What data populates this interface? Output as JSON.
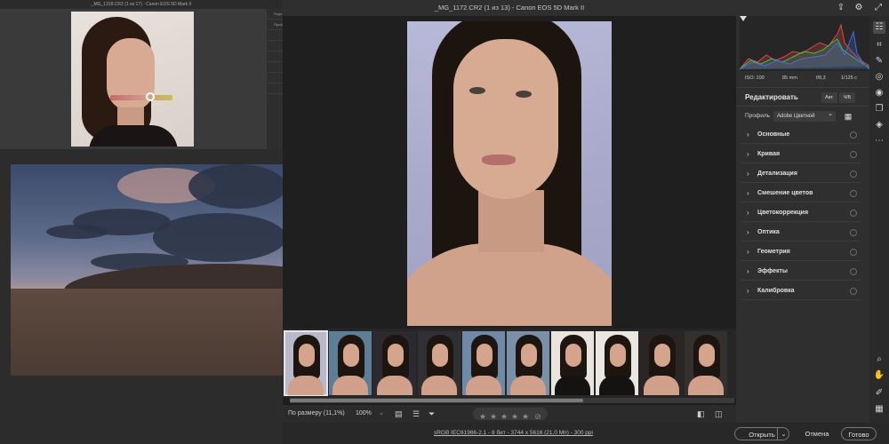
{
  "mini_window": {
    "title": "_MG_1318.CR2 (1 из 17)  · Canon EOS 5D Mark II",
    "side_rows": [
      "Реда",
      "Проф",
      "",
      "",
      "",
      "",
      "",
      "",
      "",
      ""
    ]
  },
  "window": {
    "title": "_MG_1172.CR2 (1 из 13)  -  Canon EOS 5D Mark II"
  },
  "meta": {
    "iso": "ISO: 100",
    "focal": "85 mm",
    "aperture": "f/8,3",
    "shutter": "1/125 с"
  },
  "edit": {
    "title": "Редактировать",
    "auto_label": "Авт.",
    "bw_label": "Ч/Б",
    "profile_label": "Профиль",
    "profile_value": "Adobe Цветной"
  },
  "sections": [
    {
      "label": "Основные"
    },
    {
      "label": "Кривая"
    },
    {
      "label": "Детализация"
    },
    {
      "label": "Смешение цветов"
    },
    {
      "label": "Цветокоррекция"
    },
    {
      "label": "Оптика"
    },
    {
      "label": "Геометрия"
    },
    {
      "label": "Эффекты"
    },
    {
      "label": "Калибровка"
    }
  ],
  "status": {
    "fit_label": "По размеру (11,1%)",
    "zoom_label": "100%",
    "rating_stars": 0
  },
  "footer": {
    "info": "sRGB IEC61966-2.1 - 8 бит - 3744 x 5616 (21,0 Мп) - 300 ppi",
    "open_label": "Открыть",
    "cancel_label": "Отмена",
    "done_label": "Готово"
  },
  "icons": {
    "export": "export-icon",
    "settings": "gear-icon",
    "edit_tool": "sliders-icon",
    "crop": "crop-icon",
    "heal": "healing-brush-icon",
    "mask": "mask-icon",
    "redeye": "red-eye-icon",
    "snapshots": "snapshots-icon",
    "presets": "presets-icon",
    "more": "more-icon",
    "zoom": "zoom-icon",
    "hand": "hand-icon",
    "sampler": "color-sampler-icon",
    "grid": "grid-icon"
  },
  "colors": {
    "accent_hist_red": "#e04848",
    "accent_hist_green": "#3bbf5a",
    "accent_hist_blue": "#3f6fe0",
    "button_border": "#777777"
  }
}
